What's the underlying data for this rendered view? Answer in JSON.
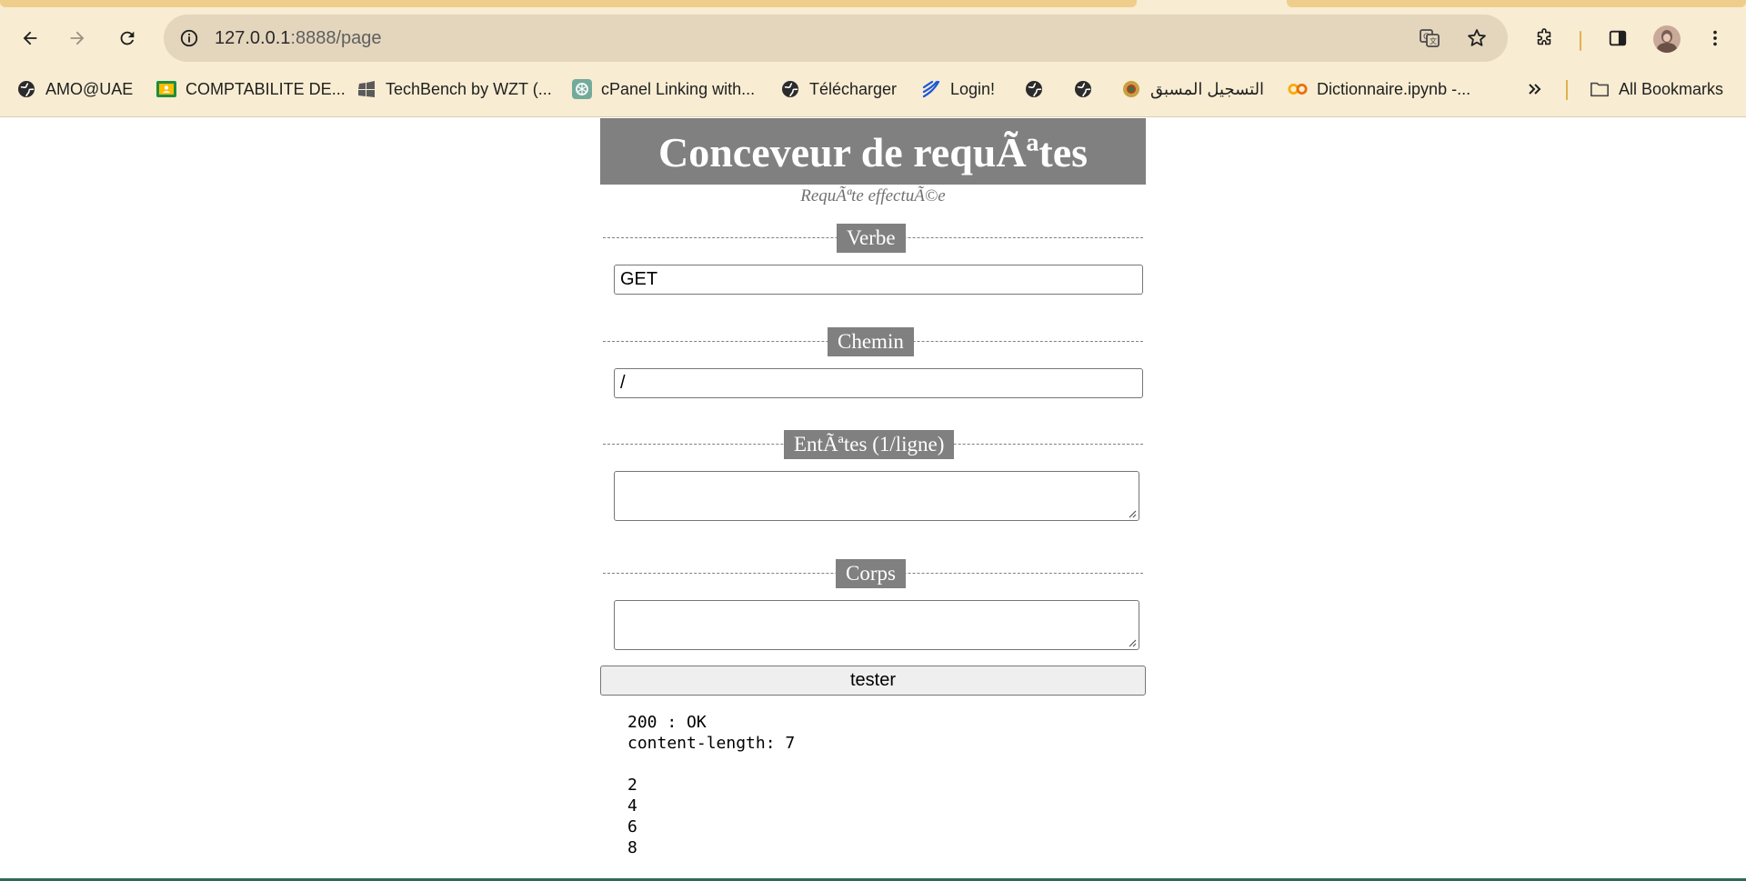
{
  "browser": {
    "url_host": "127.0.0.1",
    "url_rest": ":8888/page",
    "bookmarks": [
      {
        "label": "AMO@UAE",
        "icon": "globe-icon"
      },
      {
        "label": "COMPTABILITE DE...",
        "icon": "classroom-icon"
      },
      {
        "label": "TechBench by WZT (...",
        "icon": "windows-icon"
      },
      {
        "label": "cPanel Linking with...",
        "icon": "openai-icon"
      },
      {
        "label": "Télécharger",
        "icon": "globe-icon"
      },
      {
        "label": "Login!",
        "icon": "wave-icon"
      },
      {
        "label": "",
        "icon": "globe-icon"
      },
      {
        "label": "",
        "icon": "globe-icon"
      },
      {
        "label": "التسجيل المسبق",
        "icon": "emblem-icon"
      },
      {
        "label": "Dictionnaire.ipynb -...",
        "icon": "colab-icon"
      }
    ],
    "all_bookmarks_label": "All Bookmarks",
    "colors": {
      "chrome_bg": "#f8ecd2",
      "omnibox_bg": "#e4d6bd",
      "accent": "#e0b24d"
    }
  },
  "page": {
    "title": "Conceveur de requÃªtes",
    "subtitle": "RequÃªte effectuÃ©e",
    "sections": {
      "verbe": {
        "legend": "Verbe",
        "value": "GET"
      },
      "chemin": {
        "legend": "Chemin",
        "value": "/"
      },
      "entetes": {
        "legend": "EntÃªtes (1/ligne)",
        "value": ""
      },
      "corps": {
        "legend": "Corps",
        "value": ""
      }
    },
    "submit_label": "tester",
    "result": "200 : OK\ncontent-length: 7\n\n2\n4\n6\n8",
    "colors": {
      "legend_bg": "#808080",
      "legend_text": "#ffffff"
    }
  }
}
